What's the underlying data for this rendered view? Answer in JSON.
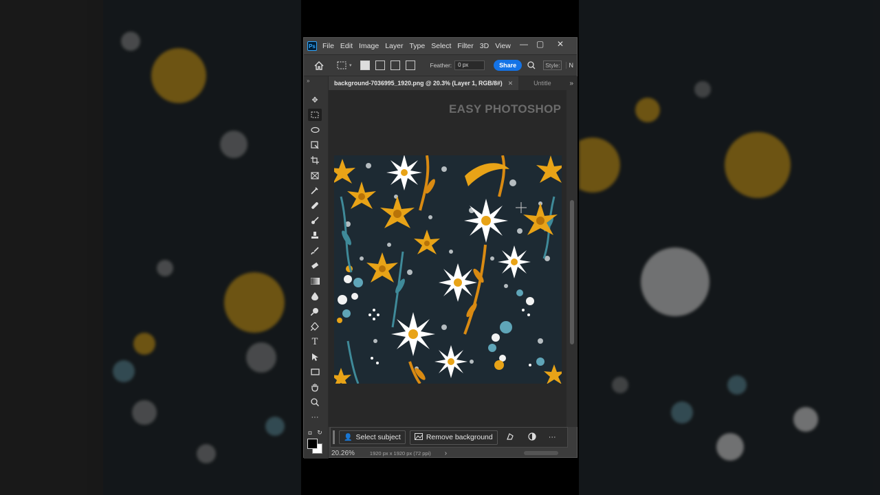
{
  "app": {
    "logo": "Ps",
    "menu": [
      "File",
      "Edit",
      "Image",
      "Layer",
      "Type",
      "Select",
      "Filter",
      "3D",
      "View"
    ],
    "window_controls": [
      "—",
      "▢",
      "✕"
    ]
  },
  "options_bar": {
    "feather_label": "Feather:",
    "feather_value": "0 px",
    "share_label": "Share",
    "style_label": "Style:",
    "overflow_label": "N"
  },
  "tabs": {
    "active": "background-7036995_1920.png @ 20.3% (Layer 1, RGB/8#)",
    "active_close": "✕",
    "inactive": "Untitle",
    "more": "»"
  },
  "canvas": {
    "watermark": "EASY PHOTOSHOP"
  },
  "taskbar": {
    "select_subject": "Select subject",
    "remove_background": "Remove background",
    "more": "···"
  },
  "status": {
    "zoom": "20.26%",
    "doc_info": "1920 px x 1920 px (72 ppi)",
    "arrow": "›"
  },
  "colors": {
    "accent": "#1473e6",
    "artwork_bg": "#1d2a33",
    "flower_yellow": "#e8a317",
    "flower_white": "#ffffff",
    "leaf_teal": "#3f8a99",
    "stem_orange": "#d98a12"
  },
  "tools": [
    "move-icon",
    "marquee-icon",
    "lasso-icon",
    "object-select-icon",
    "crop-icon",
    "frame-icon",
    "eyedropper-icon",
    "healing-icon",
    "brush-icon",
    "stamp-icon",
    "history-brush-icon",
    "eraser-icon",
    "gradient-icon",
    "blur-icon",
    "dodge-icon",
    "pen-icon",
    "type-icon",
    "path-select-icon",
    "rectangle-icon",
    "hand-icon",
    "zoom-icon",
    "more-tools-icon"
  ]
}
